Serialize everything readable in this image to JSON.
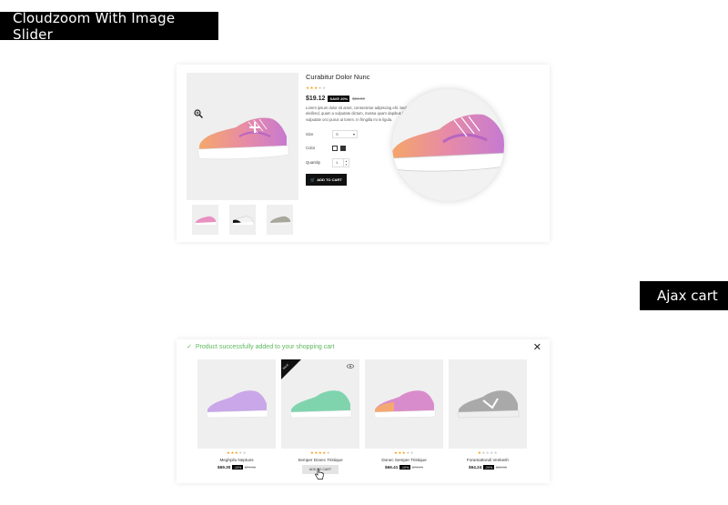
{
  "banners": {
    "top": "Cloudzoom With Image Slider",
    "right": "Ajax cart"
  },
  "detail": {
    "title": "Curabitur Dolor Nunc",
    "rating": 3,
    "price": "$19.12",
    "save_badge": "SAVE 20%",
    "old_price": "$23.90",
    "description": "Lorem ipsum dolor sit amet, consectetur adipiscing elit. Sed ante. Mauris eleifend, quam a vulputate dictum, massa quam dapibus leo, eget vulputate orci purus ut lorem. In fringilla mi in ligula.",
    "size_label": "Size",
    "size_value": "S",
    "color_label": "Color",
    "quantity_label": "Quantity",
    "quantity_value": "1",
    "add_to_cart": "ADD TO CART",
    "icons": [
      "crosshair-icon",
      "zoom-in-icon",
      "cart-icon"
    ]
  },
  "cart": {
    "success_message": "Product successfully added to your shopping cart",
    "close_label": "✕",
    "products": [
      {
        "name": "Meghpilu Neptuns",
        "rating": 3,
        "price": "$69.30",
        "badge": "-10%",
        "old_price": "$77.00",
        "color": "#c9a7e8"
      },
      {
        "name": "Semper Donec Tristique",
        "rating": 4,
        "price": "",
        "badge": "",
        "old_price": "",
        "color": "#7fd4ae",
        "sale_ribbon": "SALE",
        "button": "ADD TO CART"
      },
      {
        "name": "Donec Semper Tristique",
        "rating": 3,
        "price": "$66.41",
        "badge": "-10%",
        "old_price": "$73.79",
        "color": "#d98ccb"
      },
      {
        "name": "Foramattondi Venkesh",
        "rating": 1,
        "price": "$64.24",
        "badge": "-20%",
        "old_price": "$80.30",
        "color": "#a9a9a9"
      }
    ]
  }
}
